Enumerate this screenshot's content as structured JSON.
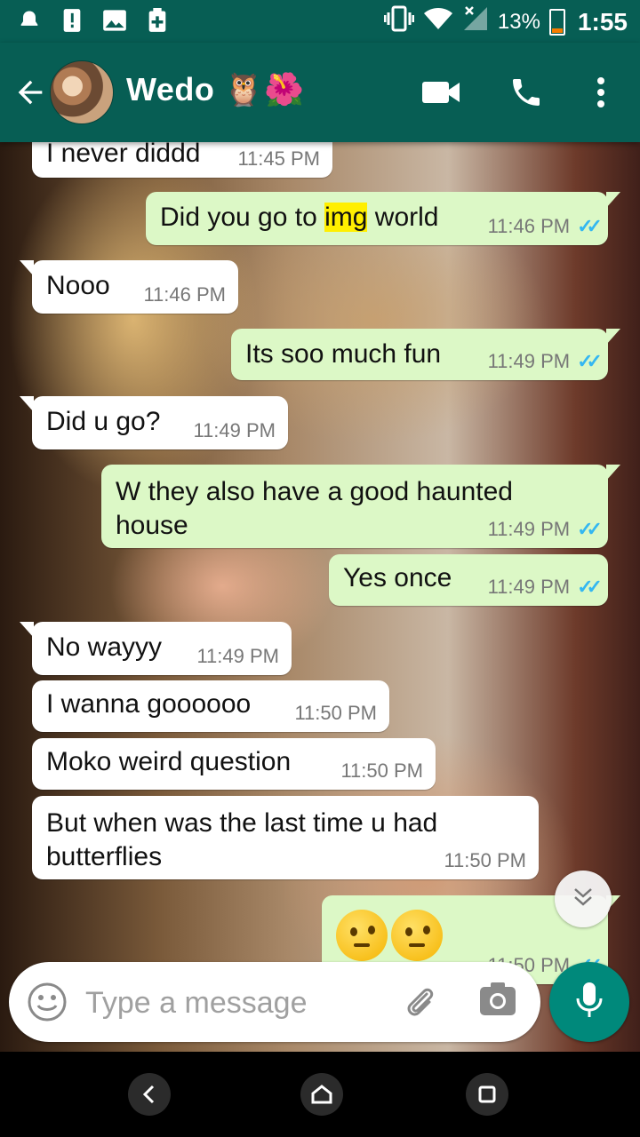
{
  "status_bar": {
    "icons": [
      "notification-icon",
      "alert-icon",
      "gallery-icon",
      "health-icon"
    ],
    "right_icons": [
      "vibrate-icon",
      "wifi-icon",
      "signal-icon"
    ],
    "battery_percent": "13%",
    "time": "1:55"
  },
  "toolbar": {
    "back_icon": "arrow-left-icon",
    "contact_name": "Wedo 🦉🌺",
    "video_icon": "video-call-icon",
    "call_icon": "phone-icon",
    "menu_icon": "more-vert-icon"
  },
  "messages": [
    {
      "dir": "in",
      "text": "I never diddd",
      "time": "11:45 PM"
    },
    {
      "dir": "out",
      "text_before": "Did you go to ",
      "highlight": "img",
      "text_after": " world",
      "time": "11:46 PM",
      "status": "read"
    },
    {
      "dir": "in",
      "text": "Nooo",
      "time": "11:46 PM"
    },
    {
      "dir": "out",
      "text": "Its soo much fun",
      "time": "11:49 PM",
      "status": "read"
    },
    {
      "dir": "in",
      "text": "Did u go?",
      "time": "11:49 PM"
    },
    {
      "dir": "out",
      "text": "W they also have a good haunted house",
      "time": "11:49 PM",
      "status": "read"
    },
    {
      "dir": "out",
      "text": "Yes once",
      "time": "11:49 PM",
      "status": "read"
    },
    {
      "dir": "in",
      "text": "No wayyy",
      "time": "11:49 PM"
    },
    {
      "dir": "in",
      "text": "I wanna goooooo",
      "time": "11:50 PM"
    },
    {
      "dir": "in",
      "text": "Moko weird question",
      "time": "11:50 PM"
    },
    {
      "dir": "in",
      "text": "But when was the last time u had butterflies",
      "time": "11:50 PM"
    },
    {
      "dir": "out",
      "text": "🤔🤔",
      "time": "11:50 PM",
      "status": "read"
    }
  ],
  "composer": {
    "emoji_icon": "smiley-icon",
    "placeholder": "Type a message",
    "value": "",
    "attach_icon": "paperclip-icon",
    "camera_icon": "camera-icon",
    "mic_icon": "microphone-icon"
  },
  "scroll_icon": "double-chevron-down-icon",
  "nav": {
    "back": "nav-back-icon",
    "home": "nav-home-icon",
    "recents": "nav-recents-icon"
  },
  "colors": {
    "header": "#075e54",
    "outgoing": "#dcf8c6",
    "incoming": "#ffffff",
    "mic": "#00897b",
    "read_ticks": "#34b7f1",
    "highlight": "#ffef00"
  }
}
